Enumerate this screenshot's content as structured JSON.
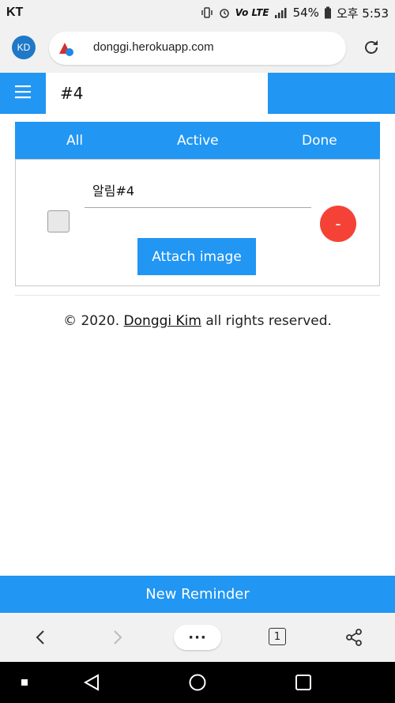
{
  "status_bar": {
    "carrier": "KT",
    "lte_label": "Vo LTE",
    "battery": "54%",
    "time": "오후 5:53"
  },
  "browser": {
    "avatar_initials": "KD",
    "url": "donggi.herokuapp.com",
    "tab_count": "1",
    "menu_label": "···"
  },
  "app": {
    "header_title": "#4",
    "tabs": [
      {
        "label": "All"
      },
      {
        "label": "Active"
      },
      {
        "label": "Done"
      }
    ],
    "todo": {
      "text": "알림#4",
      "checked": false,
      "remove_label": "-",
      "attach_label": "Attach image"
    },
    "footer": {
      "prefix": "© 2020. ",
      "author": "Donggi Kim",
      "suffix": " all rights reserved."
    },
    "new_reminder_label": "New Reminder"
  },
  "colors": {
    "primary": "#2196f3",
    "danger": "#f44336"
  }
}
